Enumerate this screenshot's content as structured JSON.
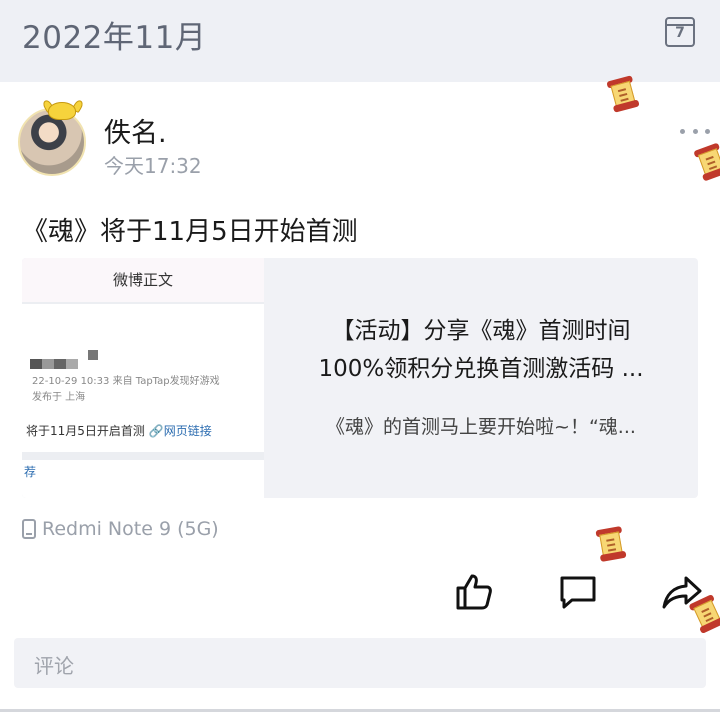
{
  "header": {
    "month_title": "2022年11月",
    "calendar_day": "7"
  },
  "post": {
    "username": "佚名.",
    "time": "今天17:32",
    "text": "《魂》将于11月5日开始首测",
    "device": "Redmi Note 9 (5G)"
  },
  "card": {
    "thumb": {
      "header": "微博正文",
      "date": "22-10-29 10:33  来自 TapTap发现好游戏",
      "location": "发布于 上海",
      "line": "将于11月5日开启首测",
      "link": "网页链接",
      "rec": "荐"
    },
    "title_line1": "【活动】分享《魂》首测时间",
    "title_line2": "100%领积分兑换首测激活码 ...",
    "description": "《魂》的首测马上要开始啦~！“魂..."
  },
  "comment": {
    "placeholder": "评论"
  }
}
